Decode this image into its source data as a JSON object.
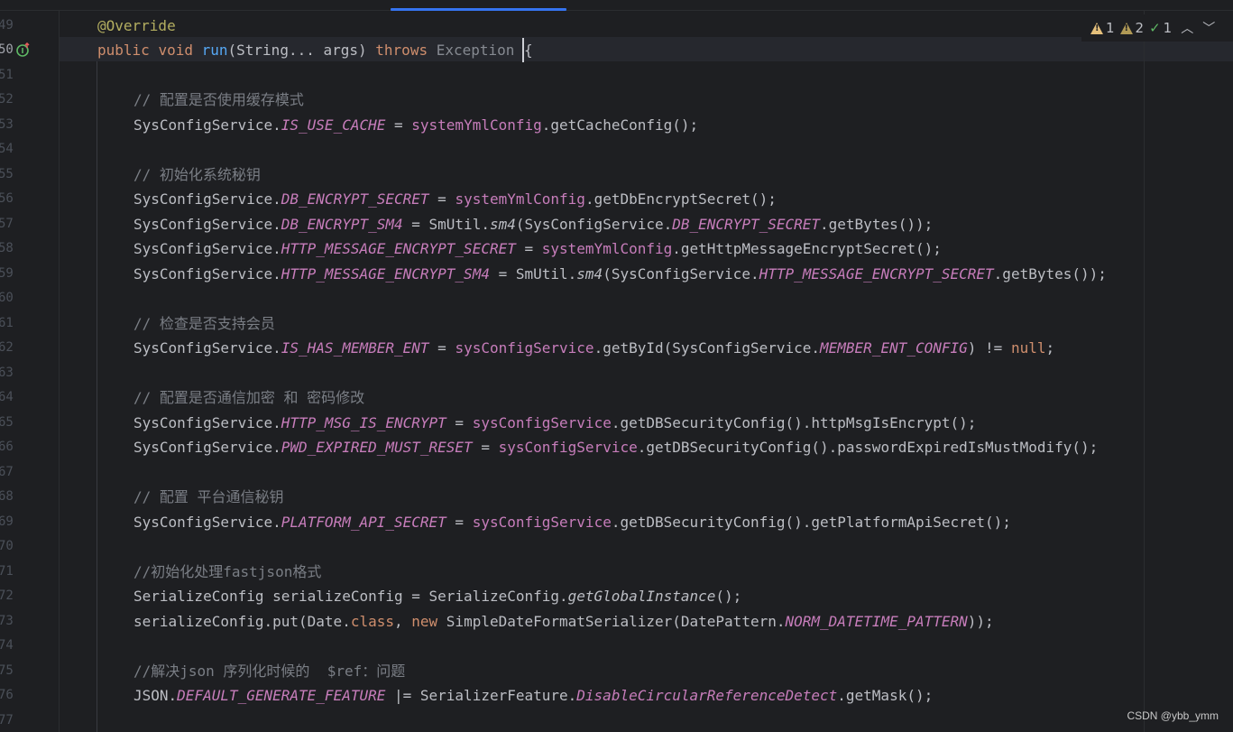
{
  "inspection": {
    "warnings": "1",
    "weak_warnings": "2",
    "typos": "1"
  },
  "watermark": "CSDN @ybb_ymm",
  "lines": [
    {
      "n": "49",
      "active": false,
      "tokens": [
        {
          "c": "ann",
          "t": "@Override"
        }
      ]
    },
    {
      "n": "50",
      "active": true,
      "tokens": [
        {
          "c": "kw",
          "t": "public "
        },
        {
          "c": "kw",
          "t": "void "
        },
        {
          "c": "fn",
          "t": "run"
        },
        {
          "c": "",
          "t": "(String... args) "
        },
        {
          "c": "kw",
          "t": "throws "
        },
        {
          "c": "ex",
          "t": "Exception "
        },
        {
          "c": "",
          "t": "{"
        }
      ]
    },
    {
      "n": "51",
      "active": false,
      "tokens": []
    },
    {
      "n": "52",
      "active": false,
      "tokens": [
        {
          "c": "cm",
          "t": "// 配置是否使用缓存模式"
        }
      ]
    },
    {
      "n": "53",
      "active": false,
      "tokens": [
        {
          "c": "",
          "t": "SysConfigService."
        },
        {
          "c": "sfld",
          "t": "IS_USE_CACHE"
        },
        {
          "c": "",
          "t": " = "
        },
        {
          "c": "fld",
          "t": "systemYmlConfig"
        },
        {
          "c": "",
          "t": ".getCacheConfig();"
        }
      ]
    },
    {
      "n": "54",
      "active": false,
      "tokens": []
    },
    {
      "n": "55",
      "active": false,
      "tokens": [
        {
          "c": "cm",
          "t": "// 初始化系统秘钥"
        }
      ]
    },
    {
      "n": "56",
      "active": false,
      "tokens": [
        {
          "c": "",
          "t": "SysConfigService."
        },
        {
          "c": "sfld",
          "t": "DB_ENCRYPT_SECRET"
        },
        {
          "c": "",
          "t": " = "
        },
        {
          "c": "fld",
          "t": "systemYmlConfig"
        },
        {
          "c": "",
          "t": ".getDbEncryptSecret();"
        }
      ]
    },
    {
      "n": "57",
      "active": false,
      "tokens": [
        {
          "c": "",
          "t": "SysConfigService."
        },
        {
          "c": "sfld",
          "t": "DB_ENCRYPT_SM4"
        },
        {
          "c": "",
          "t": " = SmUtil."
        },
        {
          "c": "sm",
          "t": "sm4"
        },
        {
          "c": "",
          "t": "(SysConfigService."
        },
        {
          "c": "sfld",
          "t": "DB_ENCRYPT_SECRET"
        },
        {
          "c": "",
          "t": ".getBytes());"
        }
      ]
    },
    {
      "n": "58",
      "active": false,
      "tokens": [
        {
          "c": "",
          "t": "SysConfigService."
        },
        {
          "c": "sfld",
          "t": "HTTP_MESSAGE_ENCRYPT_SECRET"
        },
        {
          "c": "",
          "t": " = "
        },
        {
          "c": "fld",
          "t": "systemYmlConfig"
        },
        {
          "c": "",
          "t": ".getHttpMessageEncryptSecret();"
        }
      ]
    },
    {
      "n": "59",
      "active": false,
      "tokens": [
        {
          "c": "",
          "t": "SysConfigService."
        },
        {
          "c": "sfld",
          "t": "HTTP_MESSAGE_ENCRYPT_SM4"
        },
        {
          "c": "",
          "t": " = SmUtil."
        },
        {
          "c": "sm",
          "t": "sm4"
        },
        {
          "c": "",
          "t": "(SysConfigService."
        },
        {
          "c": "sfld",
          "t": "HTTP_MESSAGE_ENCRYPT_SECRET"
        },
        {
          "c": "",
          "t": ".getBytes());"
        }
      ]
    },
    {
      "n": "60",
      "active": false,
      "tokens": []
    },
    {
      "n": "61",
      "active": false,
      "tokens": [
        {
          "c": "cm",
          "t": "// 检查是否支持会员"
        }
      ]
    },
    {
      "n": "62",
      "active": false,
      "tokens": [
        {
          "c": "",
          "t": "SysConfigService."
        },
        {
          "c": "sfld",
          "t": "IS_HAS_MEMBER_ENT"
        },
        {
          "c": "",
          "t": " = "
        },
        {
          "c": "fld",
          "t": "sysConfigService"
        },
        {
          "c": "",
          "t": ".getById(SysConfigService."
        },
        {
          "c": "sfld",
          "t": "MEMBER_ENT_CONFIG"
        },
        {
          "c": "",
          "t": ") != "
        },
        {
          "c": "kw",
          "t": "null"
        },
        {
          "c": "",
          "t": ";"
        }
      ]
    },
    {
      "n": "63",
      "active": false,
      "tokens": []
    },
    {
      "n": "64",
      "active": false,
      "tokens": [
        {
          "c": "cm",
          "t": "// 配置是否通信加密 和 密码修改"
        }
      ]
    },
    {
      "n": "65",
      "active": false,
      "tokens": [
        {
          "c": "",
          "t": "SysConfigService."
        },
        {
          "c": "sfld",
          "t": "HTTP_MSG_IS_ENCRYPT"
        },
        {
          "c": "",
          "t": " = "
        },
        {
          "c": "fld",
          "t": "sysConfigService"
        },
        {
          "c": "",
          "t": ".getDBSecurityConfig().httpMsgIsEncrypt();"
        }
      ]
    },
    {
      "n": "66",
      "active": false,
      "tokens": [
        {
          "c": "",
          "t": "SysConfigService."
        },
        {
          "c": "sfld",
          "t": "PWD_EXPIRED_MUST_RESET"
        },
        {
          "c": "",
          "t": " = "
        },
        {
          "c": "fld",
          "t": "sysConfigService"
        },
        {
          "c": "",
          "t": ".getDBSecurityConfig().passwordExpiredIsMustModify();"
        }
      ]
    },
    {
      "n": "67",
      "active": false,
      "tokens": []
    },
    {
      "n": "68",
      "active": false,
      "tokens": [
        {
          "c": "cm",
          "t": "// 配置 平台通信秘钥"
        }
      ]
    },
    {
      "n": "69",
      "active": false,
      "tokens": [
        {
          "c": "",
          "t": "SysConfigService."
        },
        {
          "c": "sfld",
          "t": "PLATFORM_API_SECRET"
        },
        {
          "c": "",
          "t": " = "
        },
        {
          "c": "fld",
          "t": "sysConfigService"
        },
        {
          "c": "",
          "t": ".getDBSecurityConfig().getPlatformApiSecret();"
        }
      ]
    },
    {
      "n": "70",
      "active": false,
      "tokens": []
    },
    {
      "n": "71",
      "active": false,
      "tokens": [
        {
          "c": "cm",
          "t": "//初始化处理fastjson格式"
        }
      ]
    },
    {
      "n": "72",
      "active": false,
      "tokens": [
        {
          "c": "",
          "t": "SerializeConfig serializeConfig = SerializeConfig."
        },
        {
          "c": "sm",
          "t": "getGlobalInstance"
        },
        {
          "c": "",
          "t": "();"
        }
      ]
    },
    {
      "n": "73",
      "active": false,
      "tokens": [
        {
          "c": "",
          "t": "serializeConfig.put(Date."
        },
        {
          "c": "kw",
          "t": "class"
        },
        {
          "c": "",
          "t": ", "
        },
        {
          "c": "kw",
          "t": "new "
        },
        {
          "c": "",
          "t": "SimpleDateFormatSerializer(DatePattern."
        },
        {
          "c": "sfld",
          "t": "NORM_DATETIME_PATTERN"
        },
        {
          "c": "",
          "t": "));"
        }
      ]
    },
    {
      "n": "74",
      "active": false,
      "tokens": []
    },
    {
      "n": "75",
      "active": false,
      "tokens": [
        {
          "c": "cm",
          "t": "//解决json 序列化时候的  $ref：问题"
        }
      ]
    },
    {
      "n": "76",
      "active": false,
      "tokens": [
        {
          "c": "",
          "t": "JSON."
        },
        {
          "c": "sfld",
          "t": "DEFAULT_GENERATE_FEATURE"
        },
        {
          "c": "",
          "t": " |= SerializerFeature."
        },
        {
          "c": "sfld",
          "t": "DisableCircularReferenceDetect"
        },
        {
          "c": "",
          "t": ".getMask();"
        }
      ]
    },
    {
      "n": "77",
      "active": false,
      "tokens": []
    }
  ]
}
